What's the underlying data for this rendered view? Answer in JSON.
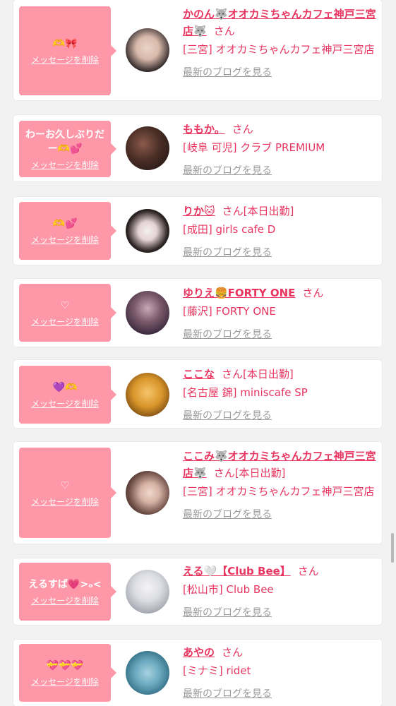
{
  "delete_label": "メッセージを削除",
  "blog_label": "最新のブログを見る",
  "san_label": "さん",
  "cards": [
    {
      "message": "🫶🎀",
      "name": "かのん🐺オオカミちゃんカフェ神戸三宮店🐺",
      "tag": "",
      "shop": "[三宮] オオカミちゃんカフェ神戸三宮店"
    },
    {
      "message": "わーお久しぶりだー🫶💕",
      "name": "ももか。",
      "tag": "",
      "shop": "[岐阜 可児] クラブ PREMIUM"
    },
    {
      "message": "🫶💕",
      "name": "りか🐱",
      "tag": "[本日出勤]",
      "shop": "[成田] girls cafe D"
    },
    {
      "message": "♡",
      "name": "ゆりえ🍔FORTY ONE",
      "tag": "",
      "shop": "[藤沢] FORTY ONE"
    },
    {
      "message": "💜🫶",
      "name": "ここな",
      "tag": "[本日出勤]",
      "shop": "[名古屋 錦] miniscafe SP"
    },
    {
      "message": "♡",
      "name": "ここみ🐺オオカミちゃんカフェ神戸三宮店🐺",
      "tag": "[本日出勤]",
      "shop": "[三宮] オオカミちゃんカフェ神戸三宮店"
    },
    {
      "message": "えるすば💗>ₒ<",
      "name": "える🤍【Club Bee】",
      "tag": "",
      "shop": "[松山市] Club Bee"
    },
    {
      "message": "💝💝💝",
      "name": "あやの",
      "tag": "",
      "shop": "[ミナミ] ridet"
    }
  ]
}
